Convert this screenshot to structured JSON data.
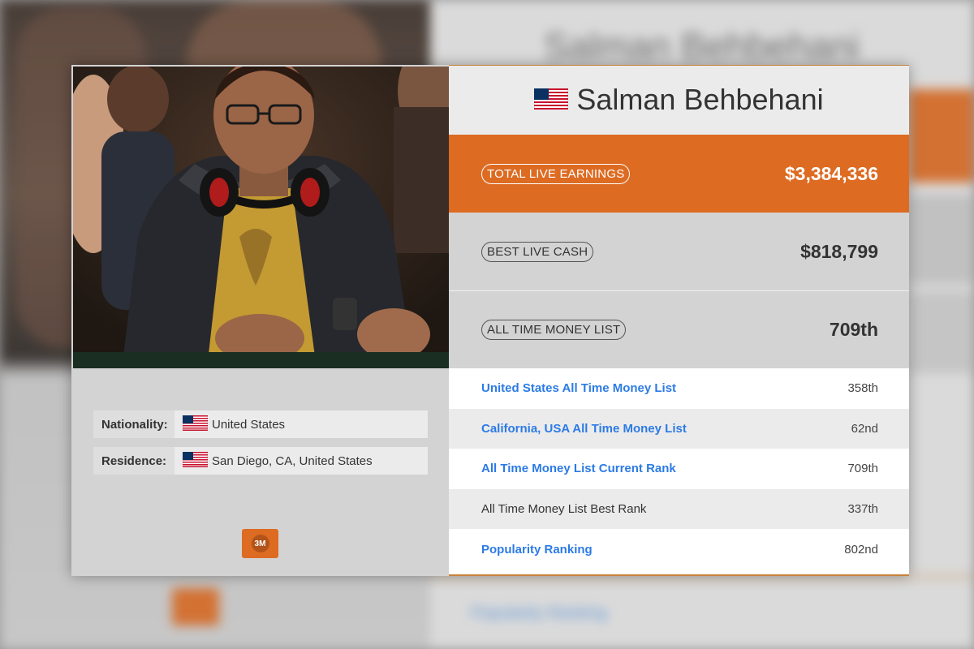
{
  "player": {
    "name": "Salman Behbehani",
    "nationality_label": "Nationality:",
    "nationality": "United States",
    "residence_label": "Residence:",
    "residence": "San Diego, CA, United States",
    "badge": "3M"
  },
  "stats": [
    {
      "label": "TOTAL LIVE EARNINGS",
      "value": "$3,384,336"
    },
    {
      "label": "BEST LIVE CASH",
      "value": "$818,799"
    },
    {
      "label": "ALL TIME MONEY LIST",
      "value": "709th"
    }
  ],
  "rankings": [
    {
      "label": "United States All Time Money List",
      "value": "358th"
    },
    {
      "label": "California, USA All Time Money List",
      "value": "62nd"
    },
    {
      "label": "All Time Money List Current Rank",
      "value": "709th"
    },
    {
      "label": "All Time Money List Best Rank",
      "value": "337th"
    },
    {
      "label": "Popularity Ranking",
      "value": "802nd"
    }
  ],
  "icons": {
    "flag": "us-flag-icon",
    "badge": "3m-badge-icon"
  },
  "colors": {
    "accent": "#dd6b22",
    "link": "#2c7be5",
    "panel": "#d3d3d3"
  }
}
